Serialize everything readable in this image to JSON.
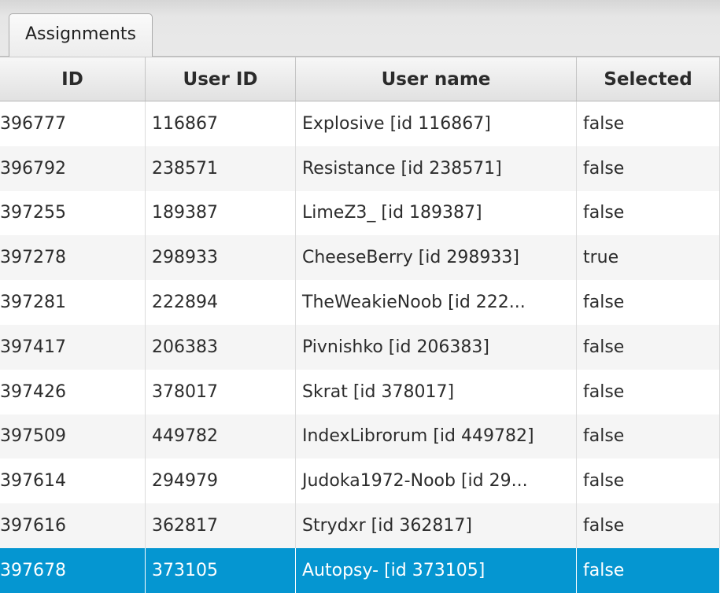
{
  "tabs": [
    {
      "label": "Assignments"
    }
  ],
  "table": {
    "columns": [
      "ID",
      "User ID",
      "User name",
      "Selected"
    ],
    "rows": [
      {
        "id": "396777",
        "user_id": "116867",
        "user_name": "Explosive [id 116867]",
        "selected": "false"
      },
      {
        "id": "396792",
        "user_id": "238571",
        "user_name": "Resistance [id 238571]",
        "selected": "false"
      },
      {
        "id": "397255",
        "user_id": "189387",
        "user_name": "LimeZ3_ [id 189387]",
        "selected": "false"
      },
      {
        "id": "397278",
        "user_id": "298933",
        "user_name": "CheeseBerry [id 298933]",
        "selected": "true"
      },
      {
        "id": "397281",
        "user_id": "222894",
        "user_name": "TheWeakieNoob [id 222...",
        "selected": "false"
      },
      {
        "id": "397417",
        "user_id": "206383",
        "user_name": "Pivnishko [id 206383]",
        "selected": "false"
      },
      {
        "id": "397426",
        "user_id": "378017",
        "user_name": "Skrat [id 378017]",
        "selected": "false"
      },
      {
        "id": "397509",
        "user_id": "449782",
        "user_name": "IndexLibrorum [id 449782]",
        "selected": "false"
      },
      {
        "id": "397614",
        "user_id": "294979",
        "user_name": "Judoka1972-Noob [id 29...",
        "selected": "false"
      },
      {
        "id": "397616",
        "user_id": "362817",
        "user_name": "Strydxr [id 362817]",
        "selected": "false"
      },
      {
        "id": "397678",
        "user_id": "373105",
        "user_name": "Autopsy- [id 373105]",
        "selected": "false"
      }
    ],
    "selected_row_color": "#0596d1"
  }
}
